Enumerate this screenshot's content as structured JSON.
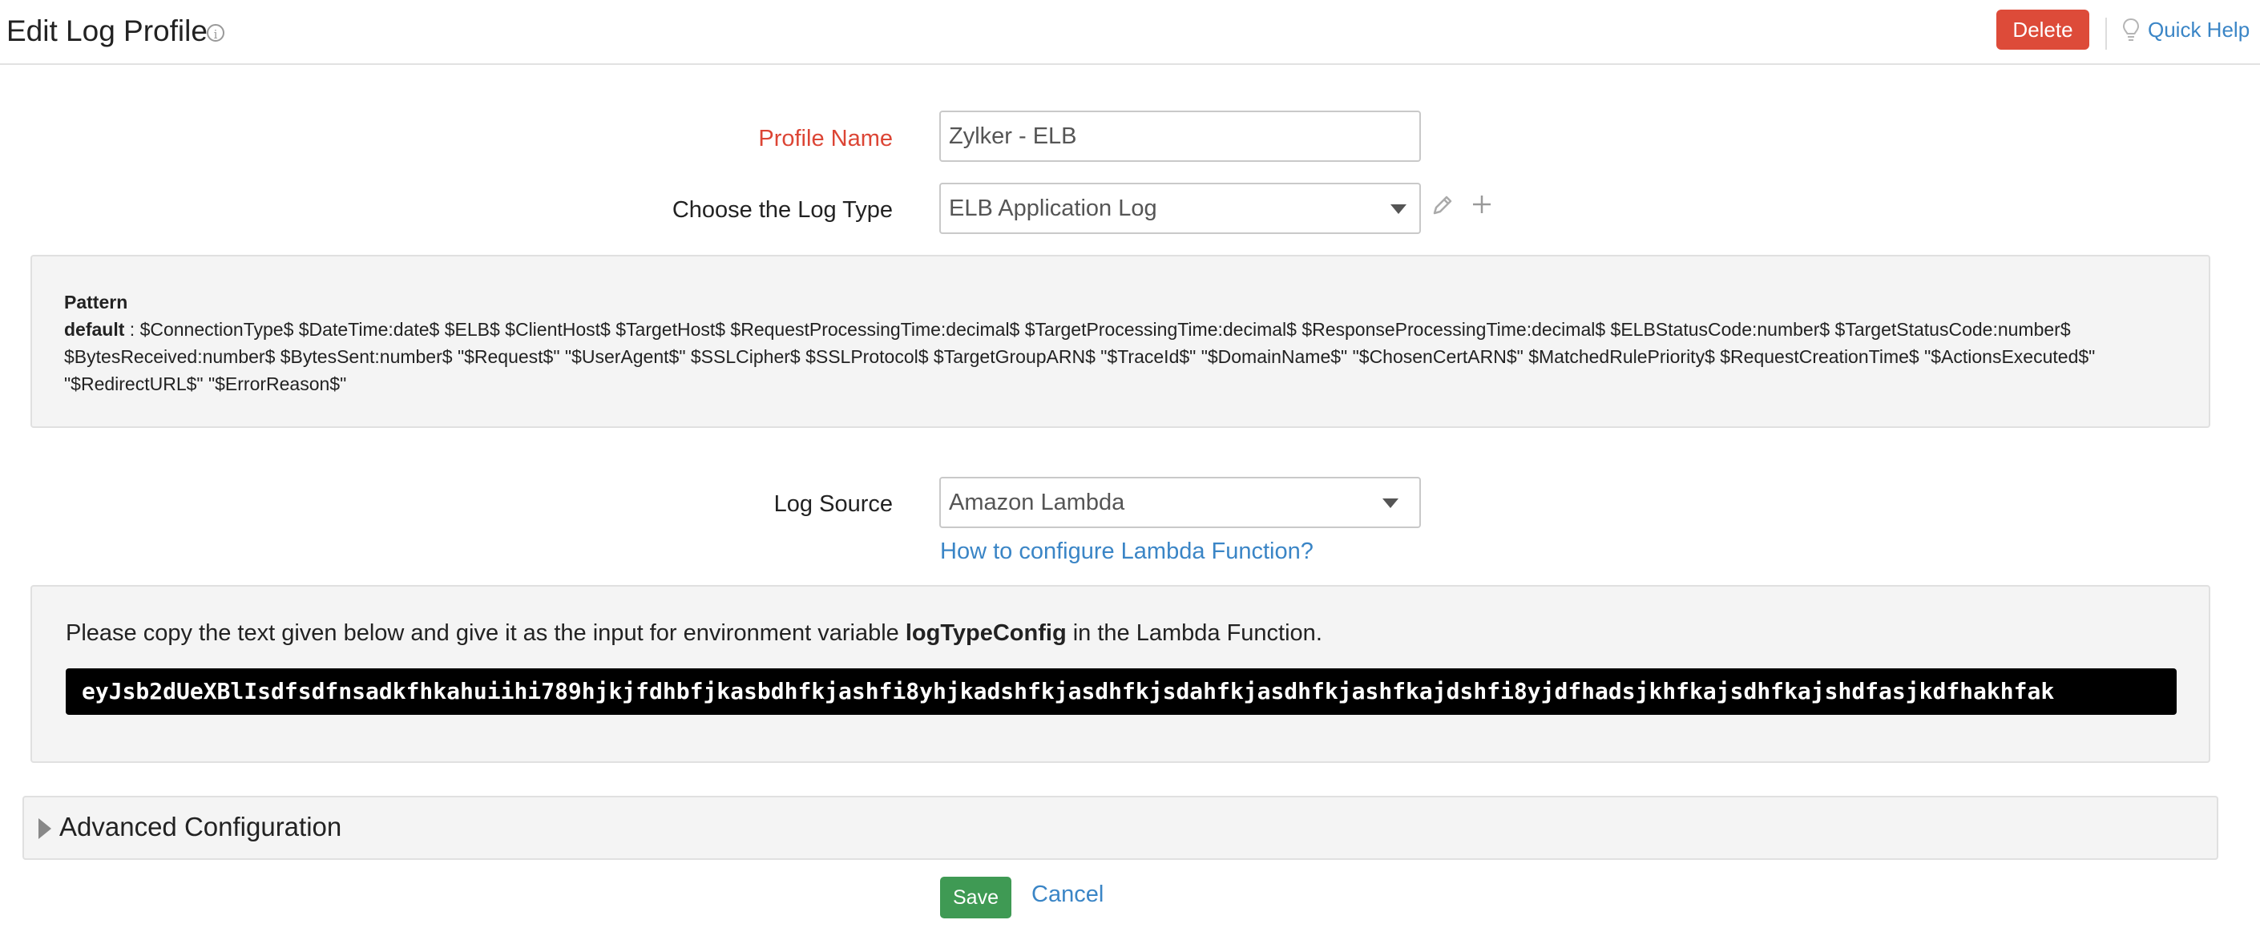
{
  "header": {
    "title": "Edit Log Profile",
    "info_glyph": "i",
    "delete_label": "Delete",
    "quick_help_label": "Quick Help"
  },
  "form": {
    "profile_name_label": "Profile Name",
    "profile_name_value": "Zylker - ELB",
    "log_type_label": "Choose the Log Type",
    "log_type_value": "ELB Application Log",
    "log_source_label": "Log Source",
    "log_source_value": "Amazon Lambda",
    "lambda_help_link": "How to configure Lambda Function?"
  },
  "pattern": {
    "title": "Pattern",
    "name": "default",
    "separator": " : ",
    "value": "$ConnectionType$ $DateTime:date$ $ELB$ $ClientHost$ $TargetHost$ $RequestProcessingTime:decimal$ $TargetProcessingTime:decimal$ $ResponseProcessingTime:decimal$ $ELBStatusCode:number$ $TargetStatusCode:number$ $BytesReceived:number$ $BytesSent:number$ \"$Request$\" \"$UserAgent$\" $SSLCipher$ $SSLProtocol$ $TargetGroupARN$ \"$TraceId$\" \"$DomainName$\" \"$ChosenCertARN$\" $MatchedRulePriority$ $RequestCreationTime$ \"$ActionsExecuted$\" \"$RedirectURL$\" \"$ErrorReason$\""
  },
  "lambda": {
    "instruction_prefix": "Please copy the text given below and give it as the input for environment variable ",
    "variable_name": "logTypeConfig",
    "instruction_suffix": " in the Lambda Function.",
    "config_text": "eyJsb2dUeXBlIsdfsdfnsadkfhkahuiihi789hjkjfdhbfjkasbdhfkjashfi8yhjkadshfkjasdhfkjsdahfkjasdhfkjashfkajdshfi8yjdfhadsjkhfkajsdhfkajshdfasjkdfhakhfak"
  },
  "advanced": {
    "label": "Advanced Configuration"
  },
  "actions": {
    "save_label": "Save",
    "cancel_label": "Cancel"
  },
  "colors": {
    "accent": "#3a85c6",
    "danger": "#dd4b39",
    "success": "#3f9a54",
    "required": "#dc4535"
  },
  "icons": [
    "info-icon",
    "lightbulb-icon",
    "pencil-icon",
    "plus-icon",
    "caret-down-icon",
    "chevron-right-icon"
  ]
}
